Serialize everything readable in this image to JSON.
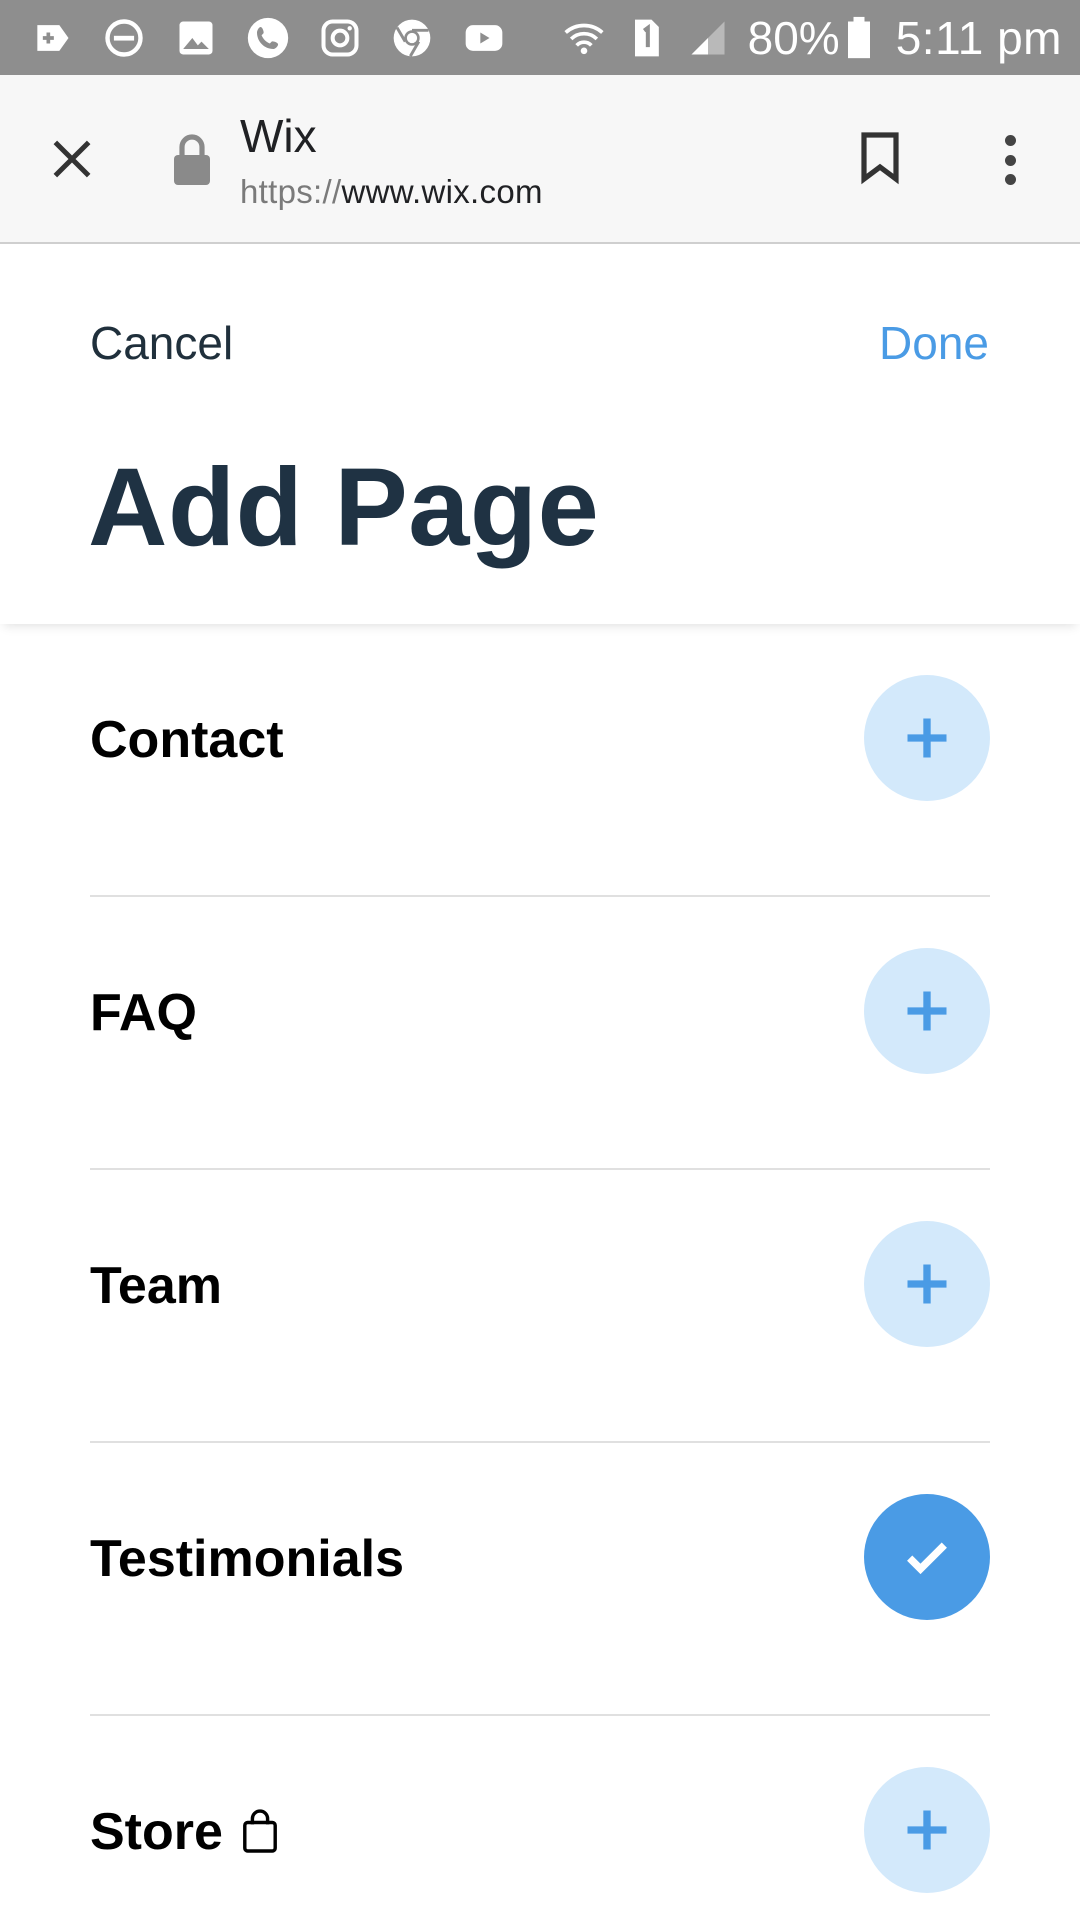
{
  "status_bar": {
    "battery": "80%",
    "time": "5:11 pm",
    "icons": [
      "add-notification-icon",
      "do-not-disturb-icon",
      "gallery-icon",
      "phone-icon",
      "instagram-icon",
      "chrome-icon",
      "youtube-icon",
      "wifi-icon",
      "sim-1-icon",
      "signal-icon",
      "battery-icon"
    ]
  },
  "browser": {
    "title": "Wix",
    "url_protocol": "https://",
    "url_host": "www.wix.com"
  },
  "header": {
    "cancel_label": "Cancel",
    "done_label": "Done",
    "title": "Add Page"
  },
  "pages": [
    {
      "label": "Contact",
      "state": "add"
    },
    {
      "label": "FAQ",
      "state": "add"
    },
    {
      "label": "Team",
      "state": "add"
    },
    {
      "label": "Testimonials",
      "state": "added"
    },
    {
      "label": "Store",
      "state": "add",
      "icon": "shopping-bag-icon"
    }
  ],
  "colors": {
    "accent": "#4a9be5",
    "accent_light": "#d3e9fb",
    "title": "#1f3243",
    "status_bar": "#8e8e8e"
  }
}
